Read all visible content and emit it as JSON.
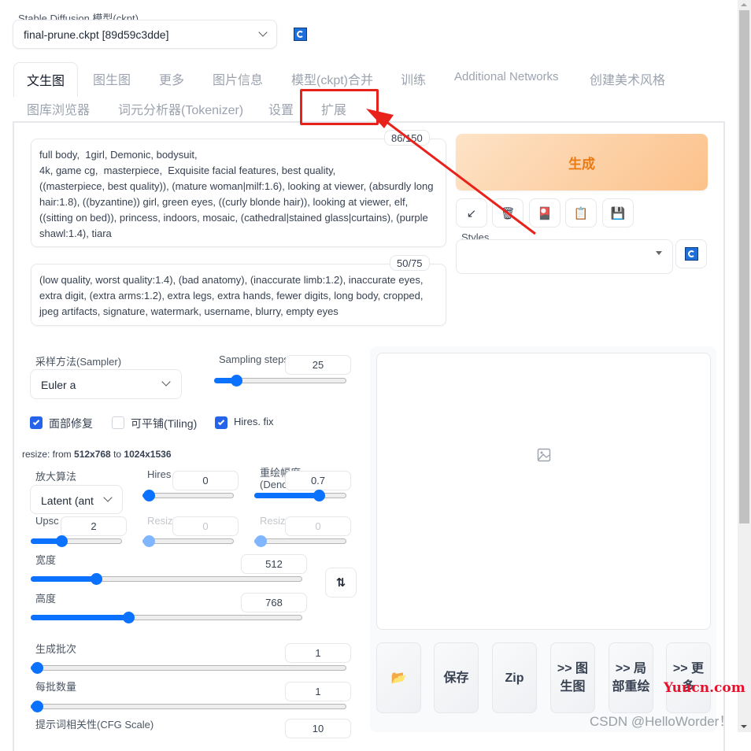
{
  "model": {
    "label": "Stable Diffusion 模型(ckpt)",
    "selected": "final-prune.ckpt [89d59c3dde]",
    "refresh_icon": "refresh-icon"
  },
  "tabs_row1": [
    {
      "label": "文生图",
      "active": true
    },
    {
      "label": "图生图"
    },
    {
      "label": "更多"
    },
    {
      "label": "图片信息"
    },
    {
      "label": "模型(ckpt)合并"
    },
    {
      "label": "训练"
    },
    {
      "label": "Additional Networks"
    },
    {
      "label": "创建美术风格"
    }
  ],
  "tabs_row2": [
    {
      "label": "图库浏览器"
    },
    {
      "label": "词元分析器(Tokenizer)"
    },
    {
      "label": "设置"
    },
    {
      "label": "扩展",
      "highlighted": true
    }
  ],
  "prompt": {
    "token_count": "86/150",
    "text": "full body,  1girl, Demonic, bodysuit,\n4k, game cg,  masterpiece,  Exquisite facial features, best quality,\n((masterpiece, best quality)), (mature woman|milf:1.6), looking at viewer, (absurdly long hair:1.8), ((byzantine)) girl, green eyes, ((curly blonde hair)), looking at viewer, elf, ((sitting on bed)), princess, indoors, mosaic, (cathedral|stained glass|curtains), (purple shawl:1.4), tiara"
  },
  "negative_prompt": {
    "token_count": "50/75",
    "text": "(low quality, worst quality:1.4), (bad anatomy), (inaccurate limb:1.2), inaccurate eyes, extra digit, (extra arms:1.2), extra legs, extra hands, fewer digits, long body, cropped, jpeg artifacts, signature, watermark, username, blurry, empty eyes"
  },
  "generate_button": "生成",
  "tool_buttons": [
    {
      "name": "read-params",
      "glyph": "↙"
    },
    {
      "name": "trash",
      "glyph": "🗑"
    },
    {
      "name": "show-extra-networks",
      "glyph": "🎴"
    },
    {
      "name": "apply-style",
      "glyph": "📋"
    },
    {
      "name": "save-style",
      "glyph": "💾"
    }
  ],
  "styles": {
    "label": "Styles",
    "selected": ""
  },
  "sampler": {
    "label": "采样方法(Sampler)",
    "selected": "Euler a"
  },
  "sampling_steps": {
    "label": "Sampling steps",
    "value": "25",
    "fraction": 0.16
  },
  "checkboxes": [
    {
      "label": "面部修复",
      "checked": true
    },
    {
      "label": "可平铺(Tiling)",
      "checked": false
    },
    {
      "label": "Hires. fix",
      "checked": true
    }
  ],
  "resize_info": {
    "prefix": "resize: from ",
    "from": "512x768",
    "middle": " to ",
    "to": "1024x1536"
  },
  "hires": {
    "upscaler": {
      "label": "放大算法",
      "selected": "Latent (ant"
    },
    "hires_steps": {
      "label": "Hires",
      "value": "0",
      "fraction": 0.0
    },
    "denoising": {
      "label": "重绘幅度(Denoising)",
      "value": "0.7",
      "fraction": 0.7
    },
    "upscale_by": {
      "label": "Upscale",
      "value": "2",
      "fraction": 0.33
    },
    "resize_width": {
      "label": "Resize",
      "value": "0",
      "fraction": 0.0
    },
    "resize_height": {
      "label": "Resize",
      "value": "0",
      "fraction": 0.0
    }
  },
  "width": {
    "label": "宽度",
    "value": "512",
    "fraction": 0.24
  },
  "height": {
    "label": "高度",
    "value": "768",
    "fraction": 0.36
  },
  "swap_icon": "⇅",
  "batch_count": {
    "label": "生成批次",
    "value": "1",
    "fraction": 0.0
  },
  "batch_size": {
    "label": "每批数量",
    "value": "1",
    "fraction": 0.0
  },
  "cfg_scale": {
    "label": "提示词相关性(CFG Scale)",
    "value": "10"
  },
  "output_buttons": [
    {
      "name": "open-folder",
      "label": "📂"
    },
    {
      "name": "save",
      "label": "保存"
    },
    {
      "name": "zip",
      "label": "Zip"
    },
    {
      "name": "send-to-img2img",
      "label": ">> 图生图"
    },
    {
      "name": "send-to-inpaint",
      "label": ">> 局部重绘"
    },
    {
      "name": "send-to-extras",
      "label": ">> 更多"
    }
  ],
  "watermarks": {
    "csdn": "CSDN @HelloWorder！",
    "site": "Yuucn.com"
  },
  "colors": {
    "accent": "#0a72ff",
    "generate_text": "#ea7a12",
    "highlight": "#e8221b"
  }
}
